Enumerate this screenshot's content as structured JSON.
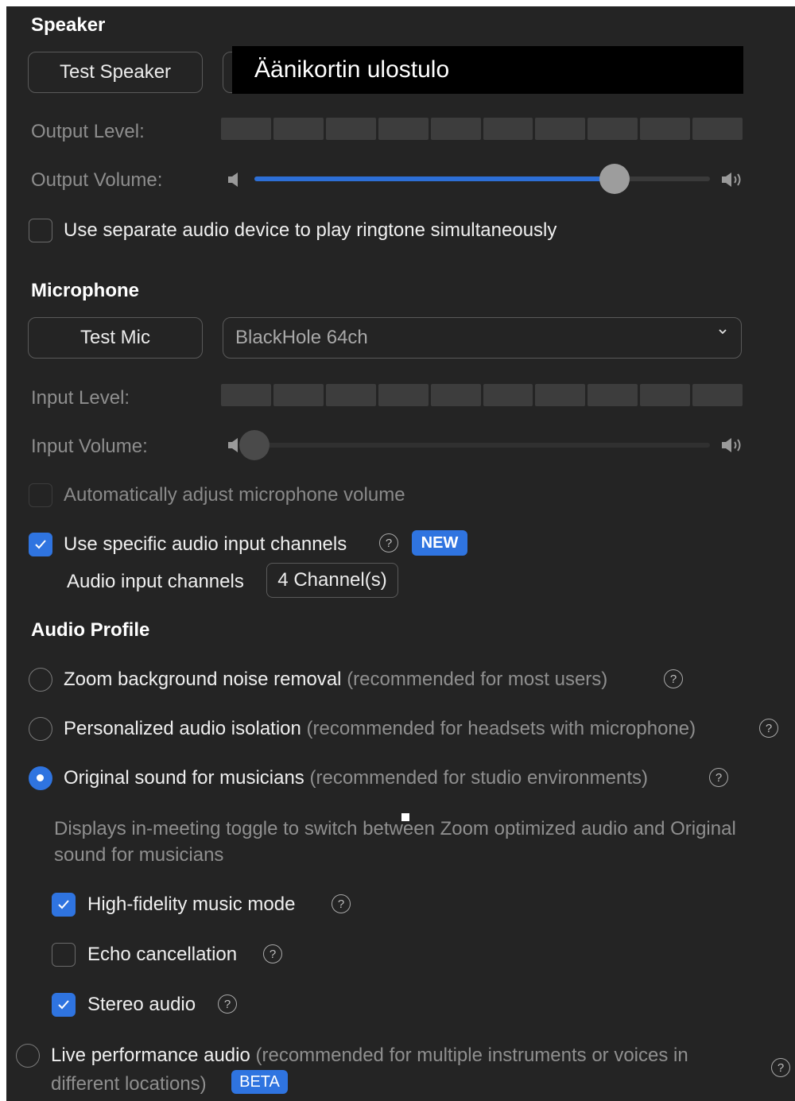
{
  "speaker": {
    "heading": "Speaker",
    "test_button": "Test Speaker",
    "device_label": "Äänikortin ulostulo",
    "output_level_label": "Output Level:",
    "output_volume_label": "Output Volume:",
    "output_volume_level": 0.79,
    "ringtone_checkbox_label": "Use separate audio device to play ringtone simultaneously",
    "ringtone_checked": false
  },
  "microphone": {
    "heading": "Microphone",
    "test_button": "Test Mic",
    "device_selected": "BlackHole 64ch",
    "input_level_label": "Input Level:",
    "input_volume_label": "Input Volume:",
    "input_volume_level": 0.0,
    "auto_adjust_label": "Automatically adjust microphone volume",
    "auto_adjust_checked": false,
    "specific_channels_label": "Use specific audio input channels",
    "specific_channels_checked": true,
    "new_badge": "NEW",
    "channels_label": "Audio input channels",
    "channels_value": "4 Channel(s)"
  },
  "audio_profile": {
    "heading": "Audio Profile",
    "options": [
      {
        "label": "Zoom background noise removal",
        "note": "(recommended for most users)",
        "selected": false
      },
      {
        "label": "Personalized audio isolation",
        "note": "(recommended for headsets with microphone)",
        "selected": false
      },
      {
        "label": "Original sound for musicians",
        "note": "(recommended for studio environments)",
        "selected": true
      },
      {
        "label": "Live performance audio",
        "note": "(recommended for multiple instruments or voices in",
        "note_line2": "different locations)",
        "badge": "BETA",
        "selected": false
      }
    ],
    "musician_description": "Displays in-meeting toggle to switch between Zoom optimized audio and Original sound for musicians",
    "sub_options": [
      {
        "label": "High-fidelity music mode",
        "checked": true
      },
      {
        "label": "Echo cancellation",
        "checked": false
      },
      {
        "label": "Stereo audio",
        "checked": true
      }
    ]
  },
  "help_glyph": "?",
  "colors": {
    "panel": "#242424",
    "accent": "#2f74e0",
    "slider_fill": "#2d6fd6"
  }
}
